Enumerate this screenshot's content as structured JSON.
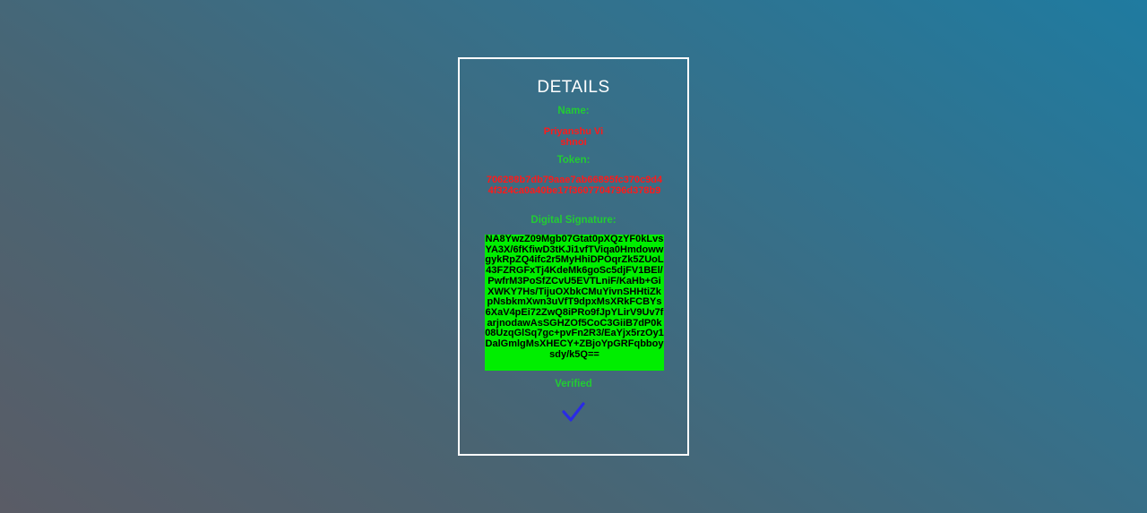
{
  "details": {
    "title": "DETAILS",
    "name_label": "Name:",
    "name_value": "Priyanshu Vishnoi",
    "token_label": "Token:",
    "token_value": "706288b7db79aae7ab66895fc370c9d44f324ca0a40be17f3607704796d378b9",
    "signature_label": "Digital Signature:",
    "signature_value": "NA8YwzZ09Mgb07Gtat0pXQzYF0kLvsYA3X/6fKfiwD3tKJi1vfTViqa0HmdowwgykRpZQ4ifc2r5MyHhiDPOqrZk5ZUoL43FZRGFxTj4KdeMk6goSc5djFV1BEl/PwfrM3PoSfZCvU5EVTLniF/KaHb+GiXWKY7Hs/TijuOXbkCMuYivnSHHtiZkpNsbkmXwn3uVfT9dpxMsXRkFCBYs6XaV4pEi72ZwQ8iPRo9fJpYLirV9Uv7farjnodawAsSGHZOf5CoC3GiiB7dP0k08UzqGlSq7gc+pvFn2R3/EaYjx5rzOy1DalGmlgMsXHECY+ZBjoYpGRFqbboysdy/k5Q==",
    "status_label": "Verified",
    "check_icon": "checkmark-icon",
    "colors": {
      "label_green": "#22cc33",
      "value_red": "#ff1a1a",
      "signature_bg": "#00ee00",
      "check_blue": "#2a2ae6"
    }
  }
}
